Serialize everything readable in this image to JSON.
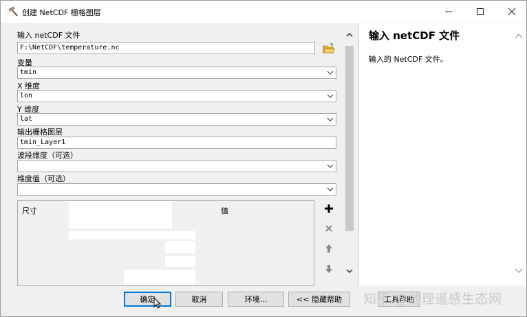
{
  "window": {
    "title": "创建 NetCDF 栅格图层",
    "icon": "hammer-tool-icon"
  },
  "params": {
    "input_file": {
      "label": "输入 netCDF 文件",
      "value": "F:\\NetCDF\\temperature.nc"
    },
    "variable": {
      "label": "变量",
      "value": "tmin"
    },
    "x_dim": {
      "label": "X 维度",
      "value": "lon"
    },
    "y_dim": {
      "label": "Y 维度",
      "value": "lat"
    },
    "output_layer": {
      "label": "输出栅格图层",
      "value": "tmin_Layer1"
    },
    "band_dim": {
      "label": "波段维度（可选）",
      "value": ""
    },
    "dim_values": {
      "label": "维度值（可选）",
      "value": ""
    },
    "table": {
      "col_size": "尺寸",
      "col_value": "值"
    }
  },
  "help": {
    "title": "输入 netCDF 文件",
    "body": "输入的 NetCDF 文件。"
  },
  "buttons": {
    "ok": "确定",
    "cancel": "取消",
    "environments": "环境...",
    "hide_help": "<< 隐藏帮助",
    "tool_help": "工具帮助"
  },
  "watermark": "知乎 @地理遥感生态网",
  "colors": {
    "accent": "#0078d7",
    "folder": "#e8b530",
    "plus": "#000000"
  }
}
